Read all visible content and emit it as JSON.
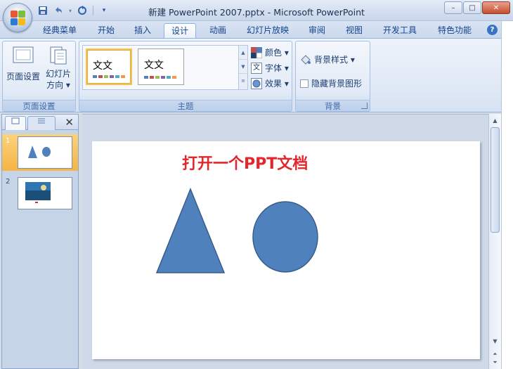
{
  "window": {
    "title": "新建 PowerPoint 2007.pptx - Microsoft PowerPoint",
    "minimize": "–",
    "maximize": "□",
    "close": "✕"
  },
  "qat": {
    "save_icon": "save-icon",
    "undo_icon": "undo-icon",
    "redo_icon": "redo-icon",
    "customize": "▾"
  },
  "tabs": [
    {
      "label": "经典菜单",
      "active": false
    },
    {
      "label": "开始",
      "active": false
    },
    {
      "label": "插入",
      "active": false
    },
    {
      "label": "设计",
      "active": true
    },
    {
      "label": "动画",
      "active": false
    },
    {
      "label": "幻灯片放映",
      "active": false
    },
    {
      "label": "审阅",
      "active": false
    },
    {
      "label": "视图",
      "active": false
    },
    {
      "label": "开发工具",
      "active": false
    },
    {
      "label": "特色功能",
      "active": false
    }
  ],
  "help": "?",
  "ribbon": {
    "page_setup": {
      "page_setup_btn": "页面设置",
      "orientation_line1": "幻灯片",
      "orientation_line2": "方向 ▾",
      "label": "页面设置"
    },
    "themes": {
      "thumb1_text": "文文",
      "thumb2_text": "文文",
      "colors": "颜色 ▾",
      "fonts": "字体 ▾",
      "effects": "效果 ▾",
      "fonts_icon_text": "文",
      "label": "主题"
    },
    "background": {
      "styles": "背景样式 ▾",
      "hide_graphics": "隐藏背景图形",
      "hide_graphics_checked": false,
      "label": "背景"
    }
  },
  "slides_pane": {
    "close": "✕",
    "slides": [
      {
        "number": "1",
        "selected": true
      },
      {
        "number": "2",
        "selected": false
      }
    ]
  },
  "slide": {
    "title": "打开一个PPT文档",
    "title_color": "#e3262b",
    "shape_fill": "#4f81bd",
    "shape_stroke": "#385d8a"
  },
  "scrollbar": {
    "up": "▲",
    "down": "▼"
  }
}
